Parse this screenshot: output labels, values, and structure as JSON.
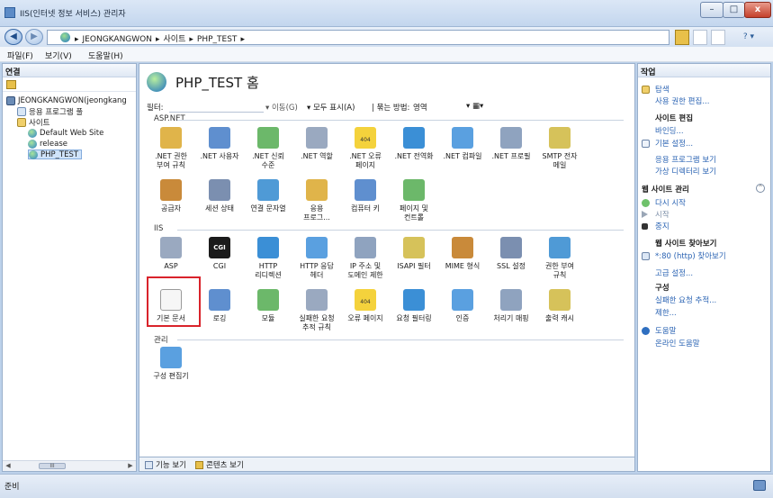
{
  "window": {
    "title": "IIS(인터넷 정보 서비스) 관리자",
    "minimize": "–",
    "maximize": "□",
    "close": "x"
  },
  "address": {
    "breadcrumbs": [
      "▸",
      "JEONGKANGWON",
      "▸",
      "사이트",
      "▸",
      "PHP_TEST",
      "▸"
    ],
    "help": "? ▾"
  },
  "menu": [
    "파일(F)",
    "보기(V)",
    "도움말(H)"
  ],
  "connections": {
    "title": "연결",
    "tree": [
      {
        "label": "JEONGKANGWON(jeongkang",
        "level": 0,
        "icon": "server"
      },
      {
        "label": "응용 프로그램 풀",
        "level": 1,
        "icon": "pool"
      },
      {
        "label": "사이트",
        "level": 1,
        "icon": "folder"
      },
      {
        "label": "Default Web Site",
        "level": 2,
        "icon": "site"
      },
      {
        "label": "release",
        "level": 2,
        "icon": "site"
      },
      {
        "label": "PHP_TEST",
        "level": 2,
        "icon": "site",
        "selected": true
      }
    ],
    "scroll_thumb": "III"
  },
  "center": {
    "title": "PHP_TEST 홈",
    "filter_label": "필터:",
    "filter_go": "▾ 이동(G)",
    "show_all": "▾ 모두 표시(A)",
    "group_by": "| 묶는 방법:",
    "group_value": "영역",
    "view_toggle": "▾ ▦▾",
    "sections": [
      {
        "name": "ASP.NET",
        "items": [
          ".NET 권한\n부여 규칙",
          ".NET 사용자",
          ".NET 신뢰\n수준",
          ".NET 역할",
          ".NET 오류\n페이지",
          ".NET 전역화",
          ".NET 컴파일",
          ".NET 프로필",
          "SMTP 전자\n메일",
          "공급자",
          "세션 상태",
          "연결 문자열",
          "응용\n프로그...",
          "컴퓨터 키",
          "페이지 및\n컨트롤"
        ]
      },
      {
        "name": "IIS",
        "items": [
          "ASP",
          "CGI",
          "HTTP\n리디렉션",
          "HTTP 응답\n헤더",
          "IP 주소 및\n도메인 제한",
          "ISAPI 필터",
          "MIME 형식",
          "SSL 설정",
          "권한 부여\n규칙",
          "기본 문서",
          "로깅",
          "모듈",
          "실패한 요청\n추적 규칙",
          "오류 페이지",
          "요청 필터링",
          "인증",
          "처리기 매핑",
          "출력 캐시"
        ]
      },
      {
        "name": "관리",
        "items": [
          "구성 편집기"
        ]
      }
    ],
    "cgi_badge": "CGI",
    "error_badge": "404",
    "tabs": {
      "features": "기능 보기",
      "content": "콘텐츠 보기"
    }
  },
  "actions": {
    "title": "작업",
    "explore": "탐색",
    "edit_perms": "사용 권한 편집...",
    "site_edit_head": "사이트 편집",
    "bindings": "바인딩...",
    "basic_settings": "기본 설정...",
    "view_apps": "응용 프로그램 보기",
    "view_vdirs": "가상 디렉터리 보기",
    "manage_head": "웹 사이트 관리",
    "collapse": "^",
    "restart": "다시 시작",
    "start": "시작",
    "stop": "중지",
    "browse_head": "웹 사이트 찾아보기",
    "browse_80": "*:80 (http) 찾아보기",
    "advanced": "고급 설정...",
    "config_head": "구성",
    "failed_trace": "실패한 요청 추적...",
    "limits": "제한...",
    "help": "도움말",
    "online_help": "온라인 도움말"
  },
  "status": {
    "text": "준비"
  },
  "colors": {
    "accent": "#2a63b3",
    "selection": "#d9232b"
  }
}
